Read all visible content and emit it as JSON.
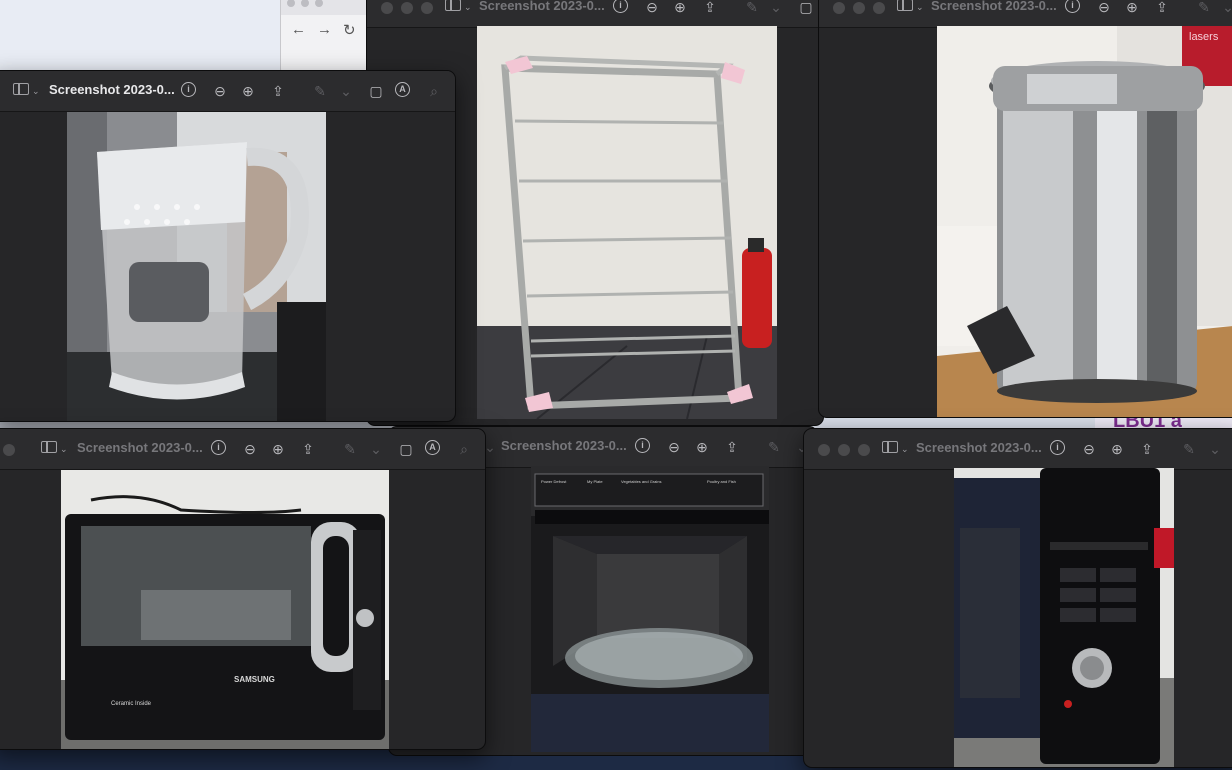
{
  "windows": [
    {
      "id": "drying-rack",
      "title": "Screenshot 2023-0..."
    },
    {
      "id": "pedal-bin",
      "title": "Screenshot 2023-0..."
    },
    {
      "id": "water-jug",
      "title": "Screenshot 2023-0..."
    },
    {
      "id": "microwave-front",
      "title": "Screenshot 2023-0..."
    },
    {
      "id": "microwave-open",
      "title": "Screenshot 2023-0..."
    },
    {
      "id": "microwave-panel",
      "title": "Screenshot 2023-0..."
    }
  ],
  "browser": {
    "back": "←",
    "forward": "→",
    "reload": "↻"
  },
  "photo_text": {
    "brand": "SAMSUNG",
    "ceramic": "Ceramic Inside",
    "lasers": "lasers",
    "panel_labels": [
      "Power Defrost",
      "My Plate",
      "Vegetables and Grains",
      "Poultry and Fish"
    ]
  },
  "icons": [
    "sidebar-icon",
    "info-icon",
    "zoom-out-icon",
    "zoom-in-icon",
    "share-icon",
    "markup-pen-icon",
    "rotate-icon",
    "annotate-icon",
    "search-icon"
  ]
}
